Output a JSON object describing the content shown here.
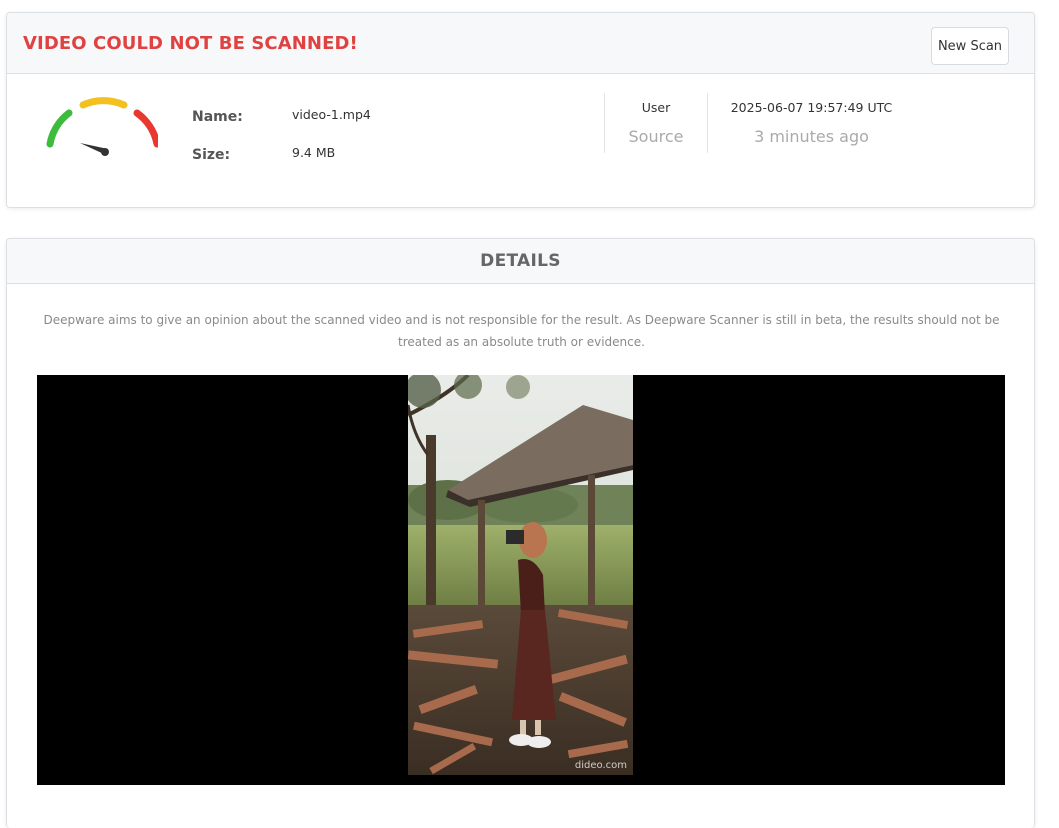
{
  "status": {
    "title": "VIDEO COULD NOT BE SCANNED!",
    "new_scan_label": "New Scan"
  },
  "file": {
    "name_label": "Name:",
    "name_value": "video-1.mp4",
    "size_label": "Size:",
    "size_value": "9.4 MB"
  },
  "meta": {
    "user_label": "User",
    "source_label": "Source",
    "timestamp": "2025-06-07 19:57:49 UTC",
    "relative_time": "3 minutes ago"
  },
  "details": {
    "title": "DETAILS",
    "disclaimer": "Deepware aims to give an opinion about the scanned video and is not responsible for the result. As Deepware Scanner is still in beta, the results should not be treated as an absolute truth or evidence."
  },
  "video": {
    "watermark": "dideo.com"
  },
  "colors": {
    "error": "#e04242",
    "gauge_green": "#3dbb3d",
    "gauge_yellow": "#f2c021",
    "gauge_red": "#e8382f"
  },
  "icons": [
    "gauge-icon"
  ]
}
